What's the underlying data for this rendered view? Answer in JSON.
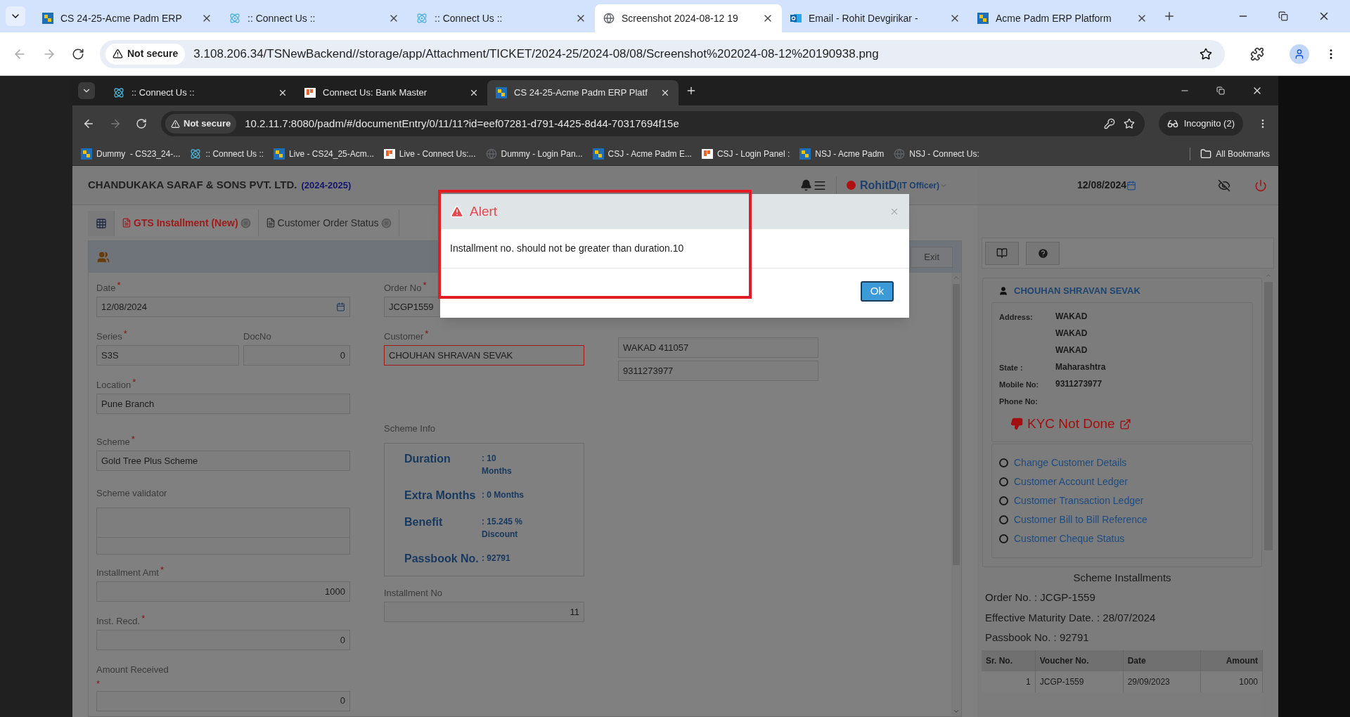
{
  "outer_browser": {
    "tabs": [
      {
        "title": "CS 24-25-Acme Padm ERP",
        "kind": "erp",
        "selected": false
      },
      {
        "title": ":: Connect Us ::",
        "kind": "react",
        "selected": false
      },
      {
        "title": ":: Connect Us ::",
        "kind": "react",
        "selected": false
      },
      {
        "title": "Screenshot 2024-08-12 19",
        "kind": "globe",
        "selected": true
      },
      {
        "title": "Email - Rohit Devgirikar - ",
        "kind": "outlook",
        "selected": false
      },
      {
        "title": "Acme Padm ERP Platform",
        "kind": "erp",
        "selected": false
      }
    ],
    "security": "Not secure",
    "url": "3.108.206.34/TSNewBackend//storage/app/Attachment/TICKET/2024-25/2024-08/08/Screenshot%202024-08-12%20190938.png"
  },
  "inner_browser": {
    "tabs": [
      {
        "title": ":: Connect Us ::",
        "kind": "react",
        "selected": false
      },
      {
        "title": "Connect Us: Bank Master",
        "kind": "connect",
        "selected": false
      },
      {
        "title": "CS 24-25-Acme Padm ERP Platf",
        "kind": "erp",
        "selected": true
      }
    ],
    "security": "Not secure",
    "url": "10.2.11.7:8080/padm/#/documentEntry/0/11/11?id=eef07281-d791-4425-8d44-70317694f15e",
    "profile": "Incognito (2)",
    "bookmarks": [
      {
        "title": "Dummy  - CS23_24-...",
        "kind": "erp"
      },
      {
        "title": ":: Connect Us ::",
        "kind": "react"
      },
      {
        "title": "Live - CS24_25-Acm...",
        "kind": "erp"
      },
      {
        "title": "Live - Connect Us:...",
        "kind": "connect"
      },
      {
        "title": "Dummy - Login Pan...",
        "kind": "globe"
      },
      {
        "title": "CSJ - Acme Padm E...",
        "kind": "erp"
      },
      {
        "title": "CSJ - Login Panel :",
        "kind": "connect"
      },
      {
        "title": "NSJ - Acme Padm",
        "kind": "erp"
      },
      {
        "title": "NSJ - Connect Us:",
        "kind": "globe"
      }
    ],
    "all_bookmarks": "All Bookmarks"
  },
  "app": {
    "company": "CHANDUKAKA SARAF & SONS PVT. LTD.",
    "year": "(2024-2025)",
    "user": "RohitD",
    "role": "(IT Officer)",
    "date": "12/08/2024",
    "tabs": [
      {
        "label": "GTS Installment (New)",
        "selected": true
      },
      {
        "label": "Customer Order Status",
        "selected": false
      }
    ],
    "exit": "Exit",
    "form": {
      "date": {
        "label": "Date",
        "mark": "*",
        "value": "12/08/2024"
      },
      "series": {
        "label": "Series",
        "mark": "*",
        "value": "S3S"
      },
      "doc_no": {
        "label": "DocNo",
        "value": "0"
      },
      "location": {
        "label": "Location",
        "mark": "*",
        "value": "Pune Branch"
      },
      "scheme": {
        "label": "Scheme",
        "mark": "*",
        "value": "Gold Tree Plus Scheme"
      },
      "scheme_validator": {
        "label": "Scheme validator"
      },
      "installment_amt": {
        "label": "Installment Amt",
        "mark": "*",
        "value": "1000"
      },
      "inst_recd": {
        "label": "Inst. Recd.",
        "mark": "*",
        "value": "0"
      },
      "amount_received": {
        "label": "Amount Received",
        "mark": "*",
        "value": "0"
      },
      "order_no": {
        "label": "Order No",
        "mark": "*",
        "value": "JCGP1559"
      },
      "customer": {
        "label": "Customer",
        "mark": "*",
        "value": "CHOUHAN SHRAVAN SEVAK",
        "invalid": true
      },
      "scheme_info": {
        "label": "Scheme Info",
        "rows": [
          {
            "label": "Duration",
            "value": ": 10 Months"
          },
          {
            "label": "Extra Months",
            "value": ": 0 Months"
          },
          {
            "label": "Benefit",
            "value": ": 15.245 % Discount"
          },
          {
            "label": "Passbook No.",
            "value": ": 92791"
          }
        ]
      },
      "installment_no": {
        "label": "Installment No",
        "value": "11"
      },
      "address_fields": [
        "WAKAD 411057",
        "9311273977"
      ]
    }
  },
  "customer_panel": {
    "name": "CHOUHAN SHRAVAN SEVAK",
    "details": [
      {
        "label": "Address:",
        "values": [
          "WAKAD",
          "WAKAD",
          "WAKAD"
        ]
      },
      {
        "label": "State :",
        "values": [
          "Maharashtra"
        ]
      },
      {
        "label": "Mobile No:",
        "values": [
          "9311273977"
        ]
      },
      {
        "label": "Phone No:"
      }
    ],
    "kyc": "KYC Not Done",
    "links": [
      {
        "label": "Change Customer Details",
        "selected": false
      },
      {
        "label": "Customer Account Ledger",
        "selected": false
      },
      {
        "label": "Customer Transaction Ledger",
        "selected": false
      },
      {
        "label": "Customer Bill to Bill Reference",
        "selected": false
      },
      {
        "label": "Customer Cheque Status",
        "selected": false
      }
    ],
    "installments_title": "Scheme Installments",
    "summary": [
      "Order No. : JCGP-1559",
      "Effective Maturity Date. : 28/07/2024",
      "Passbook No. : 92791"
    ],
    "table": {
      "columns": [
        "Sr. No.",
        "Voucher No.",
        "Date",
        "Amount"
      ],
      "rows": [
        [
          "1",
          "JCGP-1559",
          "29/09/2023",
          "1000"
        ]
      ]
    }
  },
  "modal": {
    "title": "Alert",
    "message": "Installment no. should not be greater than duration.10",
    "button": "Ok"
  }
}
